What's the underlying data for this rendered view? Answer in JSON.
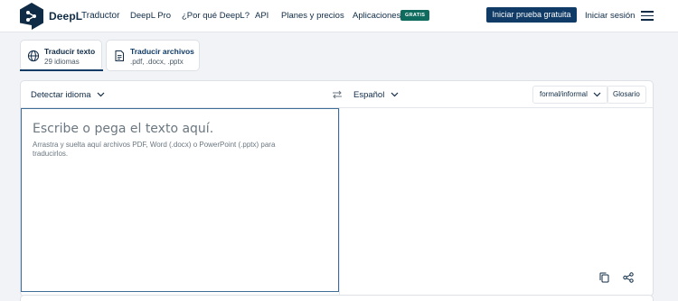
{
  "header": {
    "brand": "DeepL",
    "brand_sub": "Traductor",
    "nav": [
      "DeepL Pro",
      "¿Por qué DeepL?",
      "API",
      "Planes y precios",
      "Aplicaciones"
    ],
    "badge": "GRATIS",
    "cta": "Iniciar prueba gratuita",
    "signin": "Iniciar sesión"
  },
  "tabs": [
    {
      "title": "Traducir texto",
      "sub": "29 idiomas",
      "icon": "globe-icon"
    },
    {
      "title": "Traducir archivos",
      "sub": ".pdf, .docx, .pptx",
      "icon": "document-icon"
    }
  ],
  "translator": {
    "source_lang": "Detectar idioma",
    "target_lang": "Español",
    "formality": "formal/informal",
    "glossary": "Glosario",
    "placeholder": "Escribe o pega el texto aquí.",
    "hint": "Arrastra y suelta aquí archivos PDF, Word (.docx) o PowerPoint (.pptx) para traducirlos."
  },
  "colors": {
    "brand": "#0f2b46",
    "cta": "#0f3b66",
    "badge": "#0f6b5d",
    "page_bg": "#f1f3f6"
  }
}
